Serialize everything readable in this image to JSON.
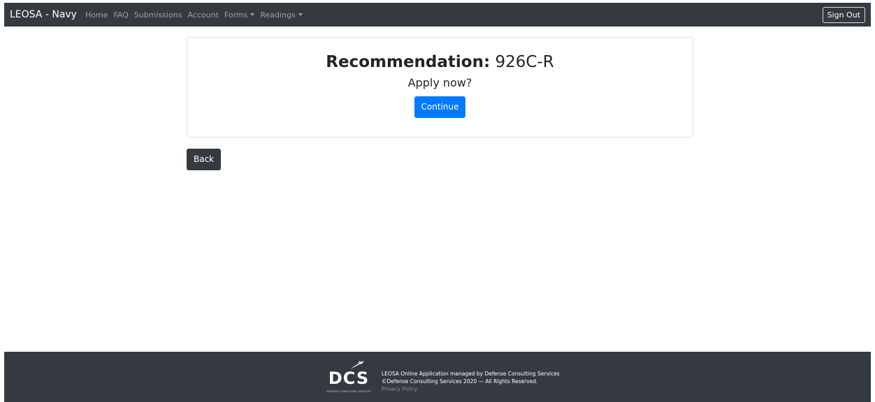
{
  "navbar": {
    "brand": "LEOSA - Navy",
    "links": [
      {
        "label": "Home"
      },
      {
        "label": "FAQ"
      },
      {
        "label": "Submissions"
      },
      {
        "label": "Account"
      },
      {
        "label": "Forms",
        "dropdown": true
      },
      {
        "label": "Readings",
        "dropdown": true
      }
    ],
    "sign_out_label": "Sign Out"
  },
  "card": {
    "recommendation_label": "Recommendation:",
    "recommendation_value": "926C-R",
    "prompt": "Apply now?",
    "continue_label": "Continue"
  },
  "back_label": "Back",
  "footer": {
    "logo_text": "DCS",
    "logo_subtitle": "DEFENSE CONSULTING SERVICES",
    "line1": "LEOSA Online Application managed by Defense Consulting Services",
    "line2": "©Defense Consulting Services 2020 — All Rights Reserved.",
    "privacy_label": "Privacy Policy"
  },
  "colors": {
    "navbar_bg": "#343a40",
    "primary": "#007bff",
    "dark": "#343a40"
  }
}
